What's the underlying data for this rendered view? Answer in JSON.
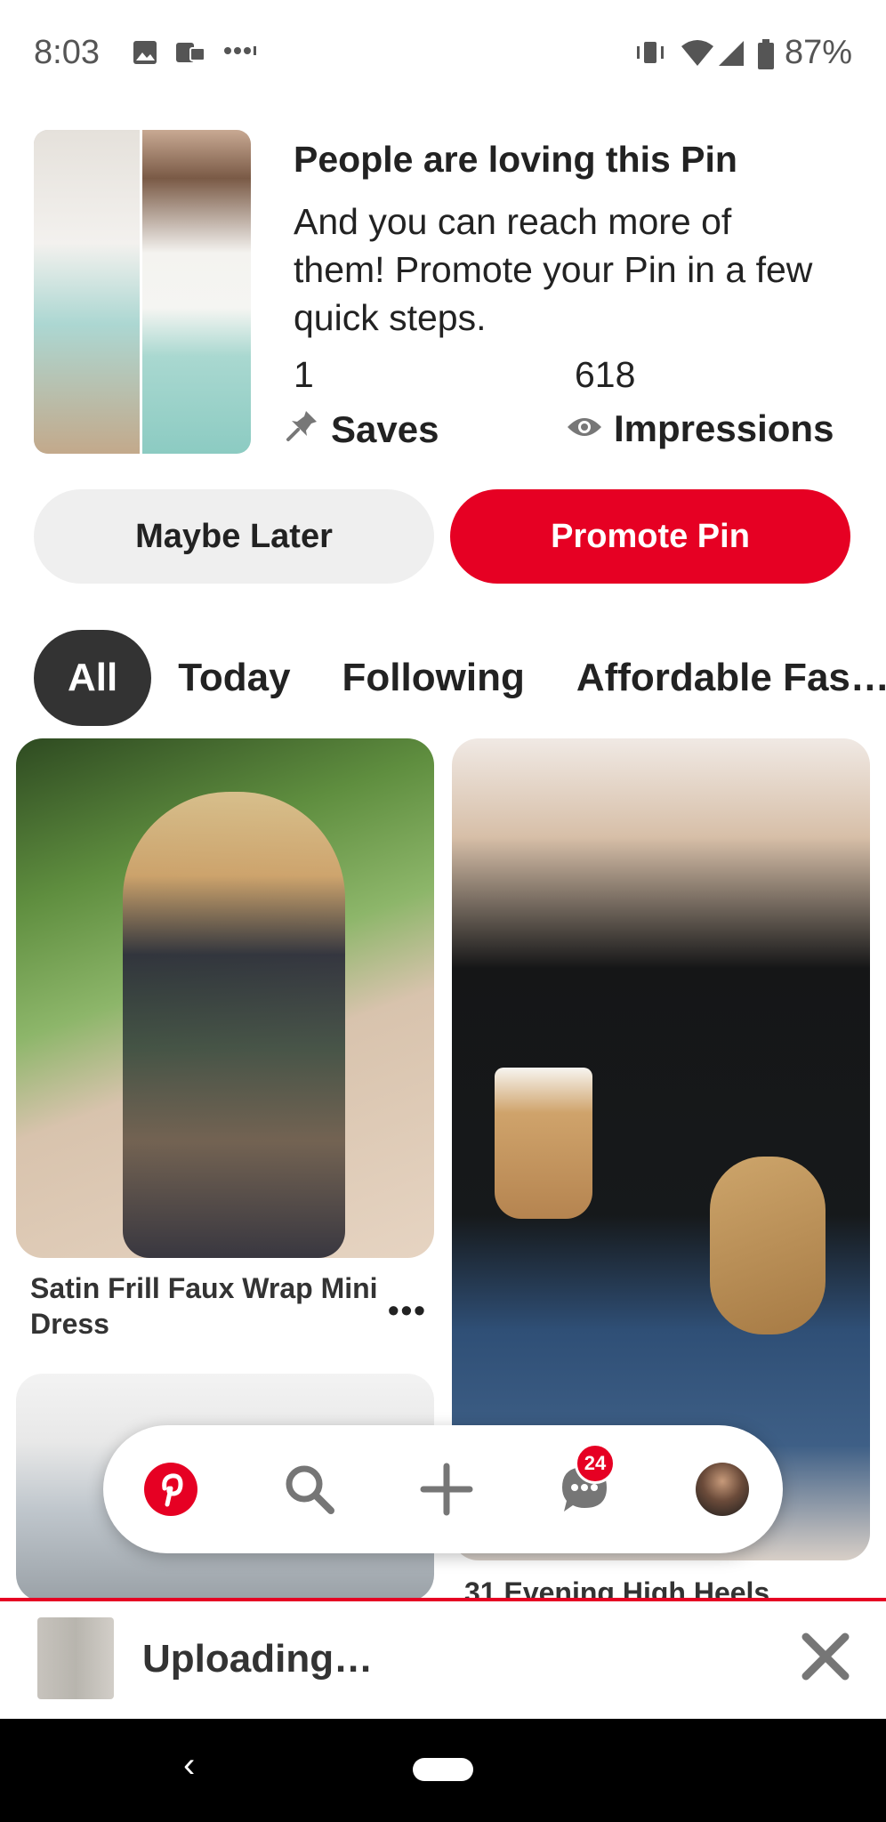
{
  "status_bar": {
    "time": "8:03",
    "battery": "87%",
    "icons": [
      "image-icon",
      "vpn-icon",
      "more-dots-icon",
      "vibrate-icon",
      "wifi-icon",
      "signal-icon",
      "battery-icon"
    ]
  },
  "promo": {
    "title": "People are loving this Pin",
    "body": "And you can reach more of them! Promote your Pin in a few quick steps.",
    "saves_count": "1",
    "saves_label": "Saves",
    "impressions_count": "618",
    "impressions_label": "Impressions",
    "maybe_later_label": "Maybe Later",
    "promote_label": "Promote Pin"
  },
  "tabs": [
    {
      "label": "All",
      "active": true
    },
    {
      "label": "Today",
      "active": false
    },
    {
      "label": "Following",
      "active": false
    },
    {
      "label": "Affordable Fas…",
      "active": false
    }
  ],
  "feed": {
    "pin1_caption": "Satin Frill Faux Wrap Mini Dress",
    "pin1_more": "•••",
    "pin2_caption": "31 Evening High Heels"
  },
  "nav": {
    "messages_badge": "24",
    "items": [
      "pinterest-home-icon",
      "search-icon",
      "plus-icon",
      "messages-icon",
      "profile-avatar"
    ]
  },
  "upload": {
    "text": "Uploading…"
  },
  "system_nav": {
    "back": "‹"
  },
  "colors": {
    "brand_red": "#e60023",
    "tab_active_bg": "#333333",
    "button_secondary_bg": "#efefef"
  }
}
